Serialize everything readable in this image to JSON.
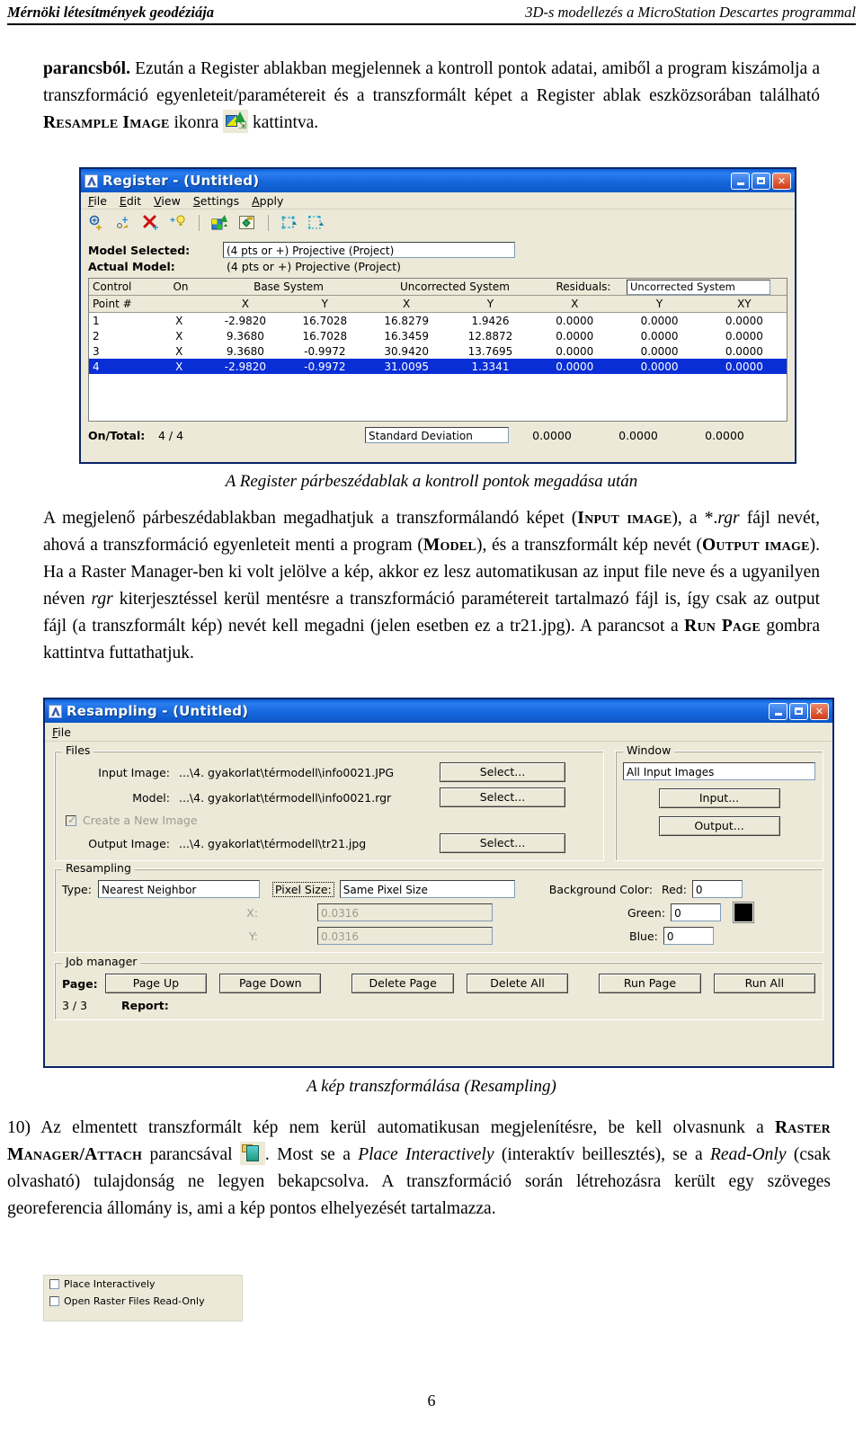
{
  "running_head": {
    "left": "Mérnöki létesítmények geodéziája",
    "right": "3D-s modellezés a MicroStation Descartes programmal"
  },
  "page_number": "6",
  "paragraphs": {
    "p1_a": "parancsból.",
    "p1_b": "Ezután a Register ablakban megjelennek a kontroll pontok adatai, amiből a program kiszámolja a transzformáció egyenleteit/paramétereit és a transzformált képet a Register ablak eszközsorában található",
    "p1_sc": "Resample Image",
    "p1_c": "ikonra",
    "p1_d": "kattintva.",
    "caption1": "A Register párbeszédablak a kontroll pontok megadása után",
    "p2_1": "A megjelenő párbeszédablakban megadhatjuk a transzformálandó képet (",
    "p2_sc1": "Input image",
    "p2_2": "), a *.",
    "p2_it1": "rgr",
    "p2_3": " fájl nevét, ahová a transzformáció egyenleteit menti a program (",
    "p2_sc2": "Model",
    "p2_4": "), és a transzformált kép nevét (",
    "p2_sc3": "Output image",
    "p2_5": "). Ha a Raster Manager-ben ki volt jelölve a kép, akkor ez lesz automatikusan az input file neve és a ugyanilyen néven ",
    "p2_it2": "rgr",
    "p2_6": " kiterjesztéssel kerül mentésre a transzformáció paramétereit tartalmazó fájl is, így csak az output fájl (a transzformált kép) nevét kell megadni (jelen esetben ez a  tr21.jpg). A parancsot a ",
    "p2_sc4": "Run Page",
    "p2_7": " gombra kattintva futtathatjuk.",
    "caption2": "A kép transzformálása (Resampling)",
    "p3_num": "10)",
    "p3_1": "Az elmentett transzformált kép nem kerül automatikusan megjelenítésre, be kell olvasnunk a ",
    "p3_sc1": "Raster Manager",
    "p3_sc2": "/Attach",
    "p3_2": " parancsával",
    "p3_3": ". Most se a ",
    "p3_it1": "Place Interactively",
    "p3_4": " (interaktív beillesztés), se a ",
    "p3_it2": "Read-Only",
    "p3_5": " (csak olvasható) tulajdonság ne legyen bekapcsolva. A transzformáció során létrehozásra került egy szöveges georeferencia állomány is, ami a kép pontos elhelyezését tartalmazza."
  },
  "register_dialog": {
    "title": "Register - (Untitled)",
    "window_buttons": [
      "minimize",
      "maximize",
      "close"
    ],
    "menu": [
      "File",
      "Edit",
      "View",
      "Settings",
      "Apply"
    ],
    "toolbar_icons": [
      "add-control-point-icon",
      "move-control-point-icon",
      "delete-control-point-icon",
      "highlight-point-icon",
      "resample-image-icon",
      "apply-transform-icon",
      "warp-display-icon",
      "fit-display-icon"
    ],
    "model_selected_label": "Model Selected:",
    "model_selected_value": "(4  pts or +) Projective (Project)",
    "actual_model_label": "Actual Model:",
    "actual_model_value": "(4  pts or +) Projective (Project)",
    "group_headers": [
      "Control",
      "On",
      "Base System",
      "Uncorrected System",
      "Residuals:"
    ],
    "residuals_dropdown": "Uncorrected System",
    "columns": [
      "Point #",
      "X",
      "Y",
      "X",
      "Y",
      "X",
      "Y",
      "XY"
    ],
    "rows": [
      {
        "point": "1",
        "on": "X",
        "bx": "-2.9820",
        "by": "16.7028",
        "ux": "16.8279",
        "uy": "1.9426",
        "rx": "0.0000",
        "ry": "0.0000",
        "rxy": "0.0000",
        "selected": false
      },
      {
        "point": "2",
        "on": "X",
        "bx": "9.3680",
        "by": "16.7028",
        "ux": "16.3459",
        "uy": "12.8872",
        "rx": "0.0000",
        "ry": "0.0000",
        "rxy": "0.0000",
        "selected": false
      },
      {
        "point": "3",
        "on": "X",
        "bx": "9.3680",
        "by": "-0.9972",
        "ux": "30.9420",
        "uy": "13.7695",
        "rx": "0.0000",
        "ry": "0.0000",
        "rxy": "0.0000",
        "selected": false
      },
      {
        "point": "4",
        "on": "X",
        "bx": "-2.9820",
        "by": "-0.9972",
        "ux": "31.0095",
        "uy": "1.3341",
        "rx": "0.0000",
        "ry": "0.0000",
        "rxy": "0.0000",
        "selected": true
      }
    ],
    "status": {
      "ontotal_label": "On/Total:",
      "ontotal_value": "4 / 4",
      "stddev_label": "Standard Deviation",
      "stddev_x": "0.0000",
      "stddev_y": "0.0000",
      "stddev_xy": "0.0000"
    }
  },
  "resampling_dialog": {
    "title": "Resampling - (Untitled)",
    "menu": [
      "File"
    ],
    "files_group": {
      "legend": "Files",
      "input_image_label": "Input Image:",
      "input_image_value": "...\\4. gyakorlat\\térmodell\\info0021.JPG",
      "model_label": "Model:",
      "model_value": "...\\4. gyakorlat\\térmodell\\info0021.rgr",
      "create_new_label": "Create a New Image",
      "create_new_checked": true,
      "output_image_label": "Output Image:",
      "output_image_value": "...\\4. gyakorlat\\térmodell\\tr21.jpg",
      "select_label": "Select..."
    },
    "window_group": {
      "legend": "Window",
      "value": "All Input Images",
      "input_button": "Input...",
      "output_button": "Output..."
    },
    "resampling_group": {
      "legend": "Resampling",
      "type_label": "Type:",
      "type_value": "Nearest Neighbor",
      "pixel_size_label": "Pixel Size:",
      "pixel_size_value": "Same Pixel Size",
      "x_label": "X:",
      "x_value": "0.0316",
      "y_label": "Y:",
      "y_value": "0.0316",
      "bg_label": "Background Color:",
      "red_label": "Red:",
      "red_value": "0",
      "green_label": "Green:",
      "green_value": "0",
      "blue_label": "Blue:",
      "blue_value": "0",
      "swatch_color": "#000000"
    },
    "job_manager": {
      "legend": "Job manager",
      "page_label": "Page:",
      "buttons": [
        "Page Up",
        "Page Down",
        "Delete Page",
        "Delete All",
        "Run Page",
        "Run All"
      ],
      "page_counter": "3 / 3",
      "report_label": "Report:"
    }
  },
  "raster_options_panel": {
    "items": [
      {
        "label": "Place Interactively",
        "checked": false
      },
      {
        "label": "Open Raster Files Read-Only",
        "checked": false
      }
    ]
  },
  "colors": {
    "title_blue": "#1667dd",
    "dialog_face": "#ece9d8",
    "selection_blue": "#0a2ed6",
    "border_blue": "#0a246a"
  }
}
